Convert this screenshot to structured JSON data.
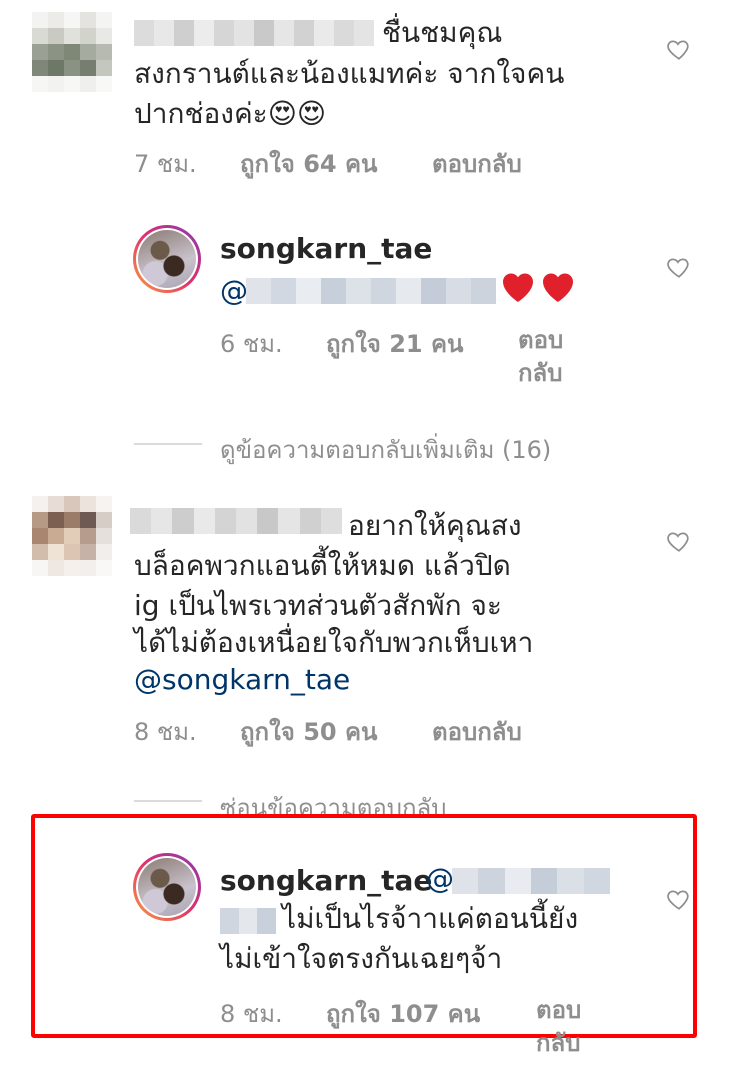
{
  "colors": {
    "text": "#262626",
    "meta": "#8e8e8e",
    "mention": "#003569",
    "highlight": "#ff0000"
  },
  "comment1": {
    "text_line1": "ชื่นชมคุณ",
    "text_line2": "สงกรานต์และน้องแมทค่ะ จากใจคน",
    "text_line3": "ปากช่องค่ะ😍😍",
    "time": "7 ชม.",
    "likes": "ถูกใจ 64 คน",
    "reply": "ตอบกลับ"
  },
  "reply1": {
    "username": "songkarn_tae",
    "mention_prefix": "@",
    "hearts": "❤️❤️",
    "time": "6 ชม.",
    "likes": "ถูกใจ 21 คน",
    "reply_line1": "ตอบ",
    "reply_line2": "กลับ"
  },
  "view_more_replies": "ดูข้อความตอบกลับเพิ่มเติม (16)",
  "comment2": {
    "text_line1": "อยากให้คุณสง",
    "text_line2": "บล็อคพวกแอนตี้ให้หมด แล้วปิด",
    "text_line3": "ig  เป็นไพรเวทส่วนตัวสักพัก จะ",
    "text_line4": "ได้ไม่ต้องเหนื่อยใจกับพวกเห็บเหา",
    "mention": "@songkarn_tae",
    "time": "8 ชม.",
    "likes": "ถูกใจ 50 คน",
    "reply": "ตอบกลับ"
  },
  "hide_replies": "ซ่อนข้อความตอบกลับ",
  "reply2": {
    "username": "songkarn_tae",
    "mention_prefix": "@",
    "text_line1": "ไม่เป็นไรจ้าาแค่ตอนนี้ยัง",
    "text_line2": "ไม่เข้าใจตรงกันเฉยๆจ้า",
    "time": "8 ชม.",
    "likes": "ถูกใจ 107 คน",
    "reply_line1": "ตอบ",
    "reply_line2": "กลับ"
  },
  "icons": {
    "like": "heart-outline-icon"
  }
}
